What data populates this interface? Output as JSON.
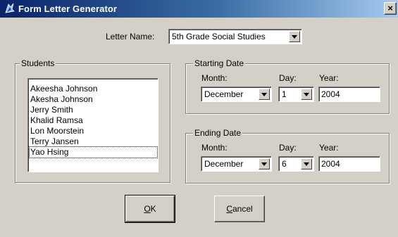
{
  "window": {
    "title": "Form Letter Generator",
    "close_label": "×"
  },
  "letter_name": {
    "label": "Letter Name:",
    "value": "5th Grade Social Studies"
  },
  "students": {
    "legend": "Students",
    "items": [
      "Akeesha Johnson",
      "Akesha Johnson",
      "Jerry Smith",
      "Khalid Ramsa",
      "Lon Moorstein",
      "Terry Jansen",
      "Yao Hsing"
    ]
  },
  "starting_date": {
    "legend": "Starting Date",
    "month_label": "Month:",
    "day_label": "Day:",
    "year_label": "Year:",
    "month": "December",
    "day": "1",
    "year": "2004"
  },
  "ending_date": {
    "legend": "Ending Date",
    "month_label": "Month:",
    "day_label": "Day:",
    "year_label": "Year:",
    "month": "December",
    "day": "6",
    "year": "2004"
  },
  "buttons": {
    "ok_first": "O",
    "ok_rest": "K",
    "cancel_first": "C",
    "cancel_rest": "ancel"
  }
}
